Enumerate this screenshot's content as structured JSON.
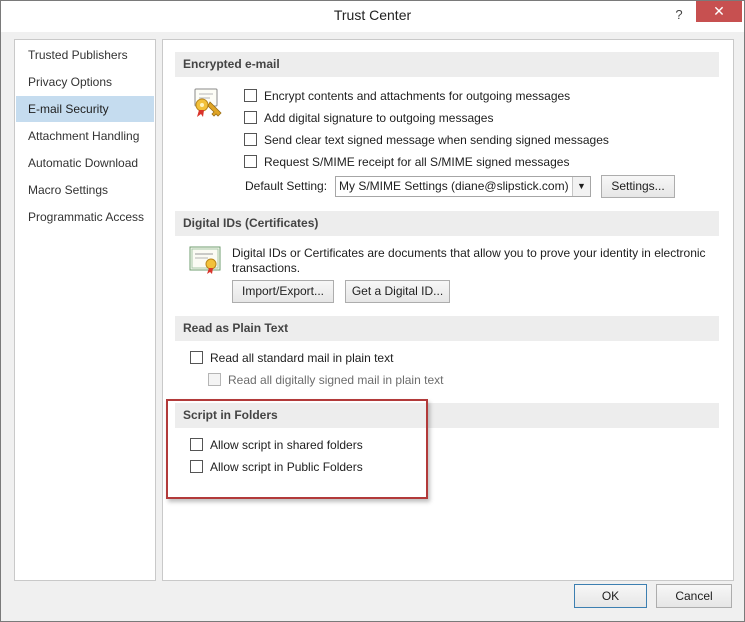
{
  "window": {
    "title": "Trust Center",
    "help_glyph": "?",
    "close_glyph": "✕"
  },
  "nav": {
    "items": [
      {
        "label": "Trusted Publishers",
        "selected": false
      },
      {
        "label": "Privacy Options",
        "selected": false
      },
      {
        "label": "E-mail Security",
        "selected": true
      },
      {
        "label": "Attachment Handling",
        "selected": false
      },
      {
        "label": "Automatic Download",
        "selected": false
      },
      {
        "label": "Macro Settings",
        "selected": false
      },
      {
        "label": "Programmatic Access",
        "selected": false
      }
    ]
  },
  "encrypted": {
    "header": "Encrypted e-mail",
    "icon": "certificate-key-icon",
    "options": [
      {
        "label": "Encrypt contents and attachments for outgoing messages",
        "checked": false
      },
      {
        "label": "Add digital signature to outgoing messages",
        "checked": false
      },
      {
        "label": "Send clear text signed message when sending signed messages",
        "checked": false
      },
      {
        "label": "Request S/MIME receipt for all S/MIME signed messages",
        "checked": false
      }
    ],
    "default_setting_label": "Default Setting:",
    "default_setting_value": "My S/MIME Settings (diane@slipstick.com)",
    "settings_button": "Settings..."
  },
  "digital_ids": {
    "header": "Digital IDs (Certificates)",
    "icon": "certificate-icon",
    "description": "Digital IDs or Certificates are documents that allow you to prove your identity in electronic transactions.",
    "import_export_button": "Import/Export...",
    "get_id_button": "Get a Digital ID..."
  },
  "plain_text": {
    "header": "Read as Plain Text",
    "read_all_standard": {
      "label": "Read all standard mail in plain text",
      "checked": false
    },
    "read_all_signed": {
      "label": "Read all digitally signed mail in plain text",
      "checked": false,
      "disabled": true
    }
  },
  "script_folders": {
    "header": "Script in Folders",
    "shared": {
      "label": "Allow script in shared folders",
      "checked": false
    },
    "public": {
      "label": "Allow script in Public Folders",
      "checked": false
    }
  },
  "footer": {
    "ok": "OK",
    "cancel": "Cancel"
  },
  "colors": {
    "selected_nav": "#c5dcef",
    "close_button": "#c75050",
    "section_header_bg": "#ededed",
    "highlight_box": "#b23a3a"
  }
}
